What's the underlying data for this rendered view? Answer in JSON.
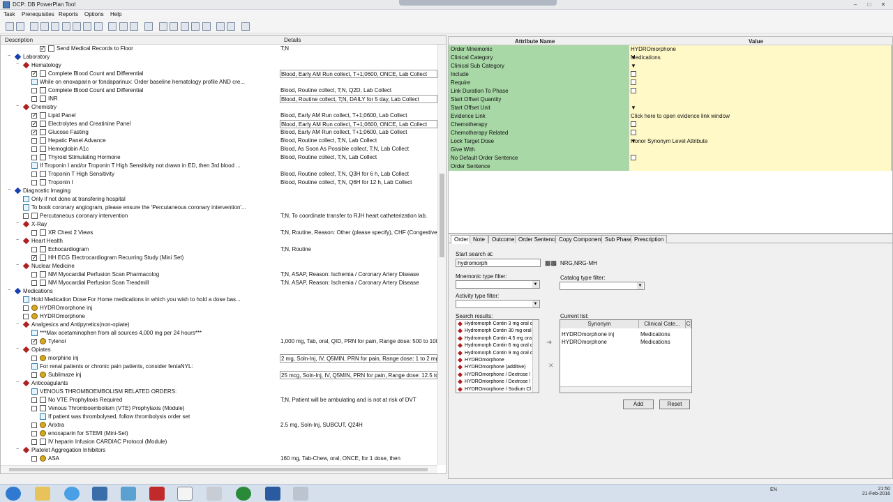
{
  "window": {
    "title": "DCP: DB PowerPlan Tool"
  },
  "menu": [
    "Task",
    "Prerequisites",
    "Reports",
    "Options",
    "Help"
  ],
  "left": {
    "col_description": "Description",
    "col_details": "Details",
    "rows": [
      {
        "indent": 3,
        "toggle": "",
        "cb": "x",
        "icon": "doc",
        "text": "Send Medical Records to Floor",
        "detail": "T;N",
        "box": false
      },
      {
        "indent": 0,
        "toggle": "-",
        "cb": "",
        "icon": "blue",
        "text": "Laboratory",
        "detail": "",
        "box": false
      },
      {
        "indent": 1,
        "toggle": "-",
        "cb": "",
        "icon": "red",
        "text": "Hematology",
        "detail": "",
        "box": false
      },
      {
        "indent": 2,
        "toggle": "",
        "cb": "x",
        "icon": "doc",
        "text": "Complete Blood Count and Differential",
        "detail": "Blood, Early AM Run collect, T+1;0600, ONCE, Lab Collect",
        "box": true
      },
      {
        "indent": 2,
        "toggle": "",
        "cb": "",
        "icon": "note",
        "text": "While on enoxaparin or fondaparinux: Order baseline hematology profile AND cre...",
        "detail": "",
        "box": false
      },
      {
        "indent": 2,
        "toggle": "",
        "cb": "o",
        "icon": "doc",
        "text": "Complete Blood Count and Differential",
        "detail": "Blood, Routine collect, T;N, Q2D, Lab Collect",
        "box": false
      },
      {
        "indent": 2,
        "toggle": "",
        "cb": "o",
        "icon": "doc",
        "text": "INR",
        "detail": "Blood, Routine collect, T;N, DAILY for 5 day, Lab Collect",
        "box": true
      },
      {
        "indent": 1,
        "toggle": "-",
        "cb": "",
        "icon": "red",
        "text": "Chemistry",
        "detail": "",
        "box": false
      },
      {
        "indent": 2,
        "toggle": "",
        "cb": "x",
        "icon": "doc",
        "text": "Lipid Panel",
        "detail": "Blood, Early AM Run collect, T+1;0600, Lab Collect",
        "box": false
      },
      {
        "indent": 2,
        "toggle": "",
        "cb": "x",
        "icon": "doc",
        "text": "Electrolytes and Creatinine Panel",
        "detail": "Blood, Early AM Run collect, T+1;0600, ONCE, Lab Collect",
        "box": true
      },
      {
        "indent": 2,
        "toggle": "",
        "cb": "x",
        "icon": "doc",
        "text": "Glucose Fasting",
        "detail": "Blood, Early AM Run collect, T+1;0600, Lab Collect",
        "box": false
      },
      {
        "indent": 2,
        "toggle": "",
        "cb": "o",
        "icon": "doc",
        "text": "Hepatic Panel Advance",
        "detail": "Blood, Routine collect, T;N, Lab Collect",
        "box": false
      },
      {
        "indent": 2,
        "toggle": "",
        "cb": "o",
        "icon": "doc",
        "text": "Hemoglobin A1c",
        "detail": "Blood, As Soon As Possible collect, T;N, Lab Collect",
        "box": false
      },
      {
        "indent": 2,
        "toggle": "",
        "cb": "o",
        "icon": "doc",
        "text": "Thyroid Stimulating Hormone",
        "detail": "Blood, Routine collect, T;N, Lab Collect",
        "box": false
      },
      {
        "indent": 2,
        "toggle": "",
        "cb": "",
        "icon": "note",
        "text": "If Troponin I and/or Troponin T High Sensitivity not drawn in ED, then 3rd blood ...",
        "detail": "",
        "box": false
      },
      {
        "indent": 2,
        "toggle": "",
        "cb": "o",
        "icon": "doc",
        "text": "Troponin T High Sensitivity",
        "detail": "Blood, Routine collect, T;N, Q3H for 6 h, Lab Collect",
        "box": false
      },
      {
        "indent": 2,
        "toggle": "",
        "cb": "o",
        "icon": "doc",
        "text": "Troponin I",
        "detail": "Blood, Routine collect, T;N, Q6H for 12 h, Lab Collect",
        "box": false
      },
      {
        "indent": 0,
        "toggle": "-",
        "cb": "",
        "icon": "blue",
        "text": "Diagnostic Imaging",
        "detail": "",
        "box": false
      },
      {
        "indent": 1,
        "toggle": "",
        "cb": "",
        "icon": "note",
        "text": "Only if not done at transfering hospital",
        "detail": "",
        "box": false
      },
      {
        "indent": 1,
        "toggle": "",
        "cb": "",
        "icon": "note",
        "text": "To book coronary angiogram, please ensure the 'Percutaneous coronary intervention'...",
        "detail": "",
        "box": false
      },
      {
        "indent": 1,
        "toggle": "",
        "cb": "o",
        "icon": "doc",
        "text": "Percutaneous coronary intervention",
        "detail": "T;N, To coordinate transfer to RJH heart catheterization lab.",
        "box": false
      },
      {
        "indent": 1,
        "toggle": "-",
        "cb": "",
        "icon": "red",
        "text": "X-Ray",
        "detail": "",
        "box": false
      },
      {
        "indent": 2,
        "toggle": "",
        "cb": "o",
        "icon": "doc",
        "text": "XR Chest 2 Views",
        "detail": "T;N, Routine, Reason: Other (please specify), CHF (Congestive He",
        "box": false
      },
      {
        "indent": 1,
        "toggle": "-",
        "cb": "",
        "icon": "red",
        "text": "Heart Health",
        "detail": "",
        "box": false
      },
      {
        "indent": 2,
        "toggle": "",
        "cb": "o",
        "icon": "doc",
        "text": "Echocardiogram",
        "detail": "T;N, Routine",
        "box": false
      },
      {
        "indent": 2,
        "toggle": "",
        "cb": "x",
        "icon": "doc",
        "text": "HH ECG Electrocardiogram Recurring Study (Mini Set)",
        "detail": "",
        "box": false
      },
      {
        "indent": 1,
        "toggle": "-",
        "cb": "",
        "icon": "red",
        "text": "Nuclear Medicine",
        "detail": "",
        "box": false
      },
      {
        "indent": 2,
        "toggle": "",
        "cb": "o",
        "icon": "doc",
        "text": "NM Myocardial Perfusion Scan Pharmacolog",
        "detail": "T;N, ASAP, Reason: Ischemia / Coronary Artery Disease",
        "box": false
      },
      {
        "indent": 2,
        "toggle": "",
        "cb": "o",
        "icon": "doc",
        "text": "NM Myocardial Perfusion Scan Treadmill",
        "detail": "T;N, ASAP, Reason: Ischemia / Coronary Artery Disease",
        "box": false
      },
      {
        "indent": 0,
        "toggle": "-",
        "cb": "",
        "icon": "blue",
        "text": "Medications",
        "detail": "",
        "box": false
      },
      {
        "indent": 1,
        "toggle": "",
        "cb": "",
        "icon": "note",
        "text": "Hold Medication Dose:For Home medications in which you wish to hold a dose bas...",
        "detail": "",
        "box": false
      },
      {
        "indent": 1,
        "toggle": "",
        "cb": "o",
        "icon": "pill",
        "text": "HYDROmorphone inj",
        "detail": "",
        "box": false
      },
      {
        "indent": 1,
        "toggle": "",
        "cb": "o",
        "icon": "pill",
        "text": "HYDROmorphone",
        "detail": "",
        "box": false
      },
      {
        "indent": 1,
        "toggle": "-",
        "cb": "",
        "icon": "red",
        "text": "Analgesics and Antipyretics(non-opiate)",
        "detail": "",
        "box": false
      },
      {
        "indent": 2,
        "toggle": "",
        "cb": "",
        "icon": "note",
        "text": "***Max acetaminophen  from all sources 4,000 mg per 24 hours***",
        "detail": "",
        "box": false
      },
      {
        "indent": 2,
        "toggle": "",
        "cb": "x",
        "icon": "pill",
        "text": "Tylenol",
        "detail": "1,000 mg, Tab, oral, QID, PRN for pain, Range dose: 500 to 1000 ...",
        "box": false
      },
      {
        "indent": 1,
        "toggle": "-",
        "cb": "",
        "icon": "red",
        "text": "Opiates",
        "detail": "",
        "box": false
      },
      {
        "indent": 2,
        "toggle": "",
        "cb": "o",
        "icon": "pill",
        "text": "morphine inj",
        "detail": "2 mg, Soln-Inj, IV, Q5MIN, PRN for pain, Range dose: 1 to 2 mg (i",
        "box": true
      },
      {
        "indent": 2,
        "toggle": "",
        "cb": "",
        "icon": "note",
        "text": "For renal patients or chronic pain patients, consider fentaNYL:",
        "detail": "",
        "box": false
      },
      {
        "indent": 2,
        "toggle": "",
        "cb": "o",
        "icon": "pill",
        "text": "Sublimaze inj",
        "detail": "25 mcg, Soln-Inj, IV, Q5MIN, PRN for pain, Range dose: 12.5 to 2",
        "box": true
      },
      {
        "indent": 1,
        "toggle": "-",
        "cb": "",
        "icon": "red",
        "text": "Anticoagulants",
        "detail": "",
        "box": false
      },
      {
        "indent": 2,
        "toggle": "",
        "cb": "",
        "icon": "note",
        "text": "VENOUS THROMBOEMBOLISM RELATED ORDERS:",
        "detail": "",
        "box": false
      },
      {
        "indent": 2,
        "toggle": "",
        "cb": "o",
        "icon": "doc",
        "text": "No VTE Prophylaxis Required",
        "detail": "T;N, Patient will be ambulating and is not at risk of DVT",
        "box": false
      },
      {
        "indent": 2,
        "toggle": "",
        "cb": "o",
        "icon": "doc",
        "text": "Venous Thromboembolism (VTE) Prophylaxis (Module)",
        "detail": "",
        "box": false
      },
      {
        "indent": 3,
        "toggle": "",
        "cb": "",
        "icon": "note",
        "text": "If patient was thrombolysed, follow thrombolysis order set",
        "detail": "",
        "box": false
      },
      {
        "indent": 2,
        "toggle": "",
        "cb": "o",
        "icon": "pill",
        "text": "Arixtra",
        "detail": "2.5 mg, Soln-Inj, SUBCUT, Q24H",
        "box": false
      },
      {
        "indent": 2,
        "toggle": "",
        "cb": "o",
        "icon": "pill",
        "text": "enoxaparin for STEMI (Mini-Set)",
        "detail": "",
        "box": false
      },
      {
        "indent": 2,
        "toggle": "",
        "cb": "o",
        "icon": "doc",
        "text": "IV heparin Infusion CARDIAC Protocol (Module)",
        "detail": "",
        "box": false
      },
      {
        "indent": 1,
        "toggle": "-",
        "cb": "",
        "icon": "red",
        "text": "Platelet Aggregation Inhibitors",
        "detail": "",
        "box": false
      },
      {
        "indent": 2,
        "toggle": "",
        "cb": "o",
        "icon": "pill",
        "text": "ASA",
        "detail": "160 mg, Tab-Chew, oral, ONCE, for 1 dose, then",
        "box": false
      }
    ]
  },
  "attributes": {
    "col_name": "Attribute Name",
    "col_value": "Value",
    "rows": [
      {
        "name": "Order Mnemonic",
        "value": "HYDROmorphone",
        "kind": "text"
      },
      {
        "name": "Clinical Category",
        "value": "Medications",
        "kind": "dropdown"
      },
      {
        "name": "Clinical Sub Category",
        "value": "",
        "kind": "dropdown"
      },
      {
        "name": "Include",
        "value": "",
        "kind": "checkbox"
      },
      {
        "name": "Require",
        "value": "",
        "kind": "checkbox"
      },
      {
        "name": "Link Duration To Phase",
        "value": "",
        "kind": "checkbox"
      },
      {
        "name": "Start Offset Quantity",
        "value": "",
        "kind": "text"
      },
      {
        "name": "Start Offset Unit",
        "value": "",
        "kind": "dropdown"
      },
      {
        "name": "Evidence Link",
        "value": "Click here to open evidence link window",
        "kind": "text"
      },
      {
        "name": "Chemotherapy",
        "value": "",
        "kind": "checkbox"
      },
      {
        "name": "Chemotherapy Related",
        "value": "",
        "kind": "checkbox"
      },
      {
        "name": "Lock Target Dose",
        "value": "Honor Synonym Level Attribute",
        "kind": "dropdown"
      },
      {
        "name": "Give With",
        "value": "",
        "kind": "text"
      },
      {
        "name": "No Default Order Sentence",
        "value": "",
        "kind": "checkbox"
      },
      {
        "name": "Order Sentence",
        "value": "",
        "kind": "text"
      }
    ]
  },
  "bottom": {
    "tabs": [
      "Order",
      "Note",
      "Outcome",
      "Order Sentence",
      "Copy Components",
      "Sub Phase",
      "Prescription"
    ],
    "start_search_label": "Start search at:",
    "search_value": "hydromorph",
    "search_tag": "NRG,NRG-MH",
    "mnemonic_filter_label": "Mnemonic type filter:",
    "catalog_filter_label": "Catalog type filter:",
    "activity_filter_label": "Activity type filter:",
    "search_results_label": "Search results:",
    "current_list_label": "Current list:",
    "results": [
      "Hydromorph Contin 3 mg oral c",
      "Hydromorph Contin 30 mg oral",
      "Hydromorph Contin 4.5 mg ora",
      "Hydromorph Contin 6 mg oral c",
      "Hydromorph Contin 9 mg oral c",
      "HYDROmorphone",
      "HYDROmorphone (additive)",
      "HYDROmorphone / Dextrose !",
      "HYDROmorphone / Dextrose !",
      "HYDROmorphone / Sodium Cl"
    ],
    "current_cols": [
      "Synonym",
      "Clinical Cate...",
      "C"
    ],
    "current_rows": [
      [
        "HYDROmorphone inj",
        "Medications"
      ],
      [
        "HYDROmorphone",
        "Medications"
      ]
    ],
    "add_label": "Add",
    "reset_label": "Reset"
  },
  "taskbar": {
    "language": "EN",
    "time": "21:50",
    "date": "21-Feb-2016"
  }
}
